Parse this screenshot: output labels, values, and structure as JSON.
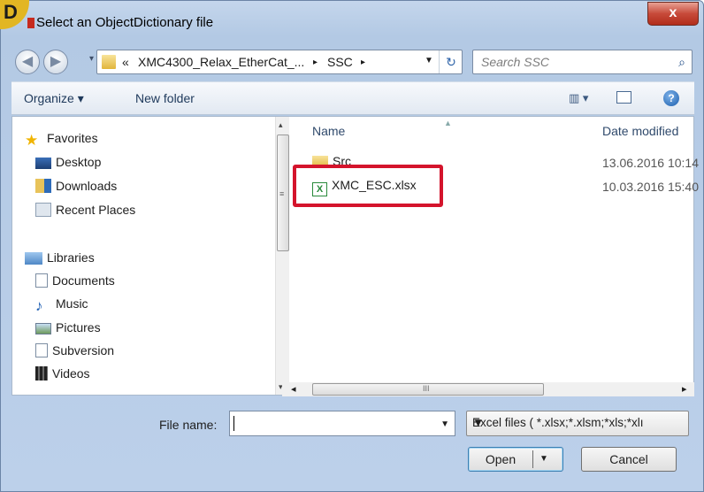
{
  "window": {
    "title": "Select an ObjectDictionary file",
    "close_label": "x",
    "badge_letter": "D"
  },
  "address": {
    "history": "«",
    "crumbs": [
      "XMC4300_Relax_EtherCat_...",
      "SSC"
    ],
    "sep": "▸",
    "refresh": "↻"
  },
  "search": {
    "placeholder": "Search SSC",
    "icon": "⌕"
  },
  "toolbar": {
    "organize": "Organize ▾",
    "new_folder": "New folder",
    "views": "▥ ▾",
    "help": "?"
  },
  "nav": {
    "favorites": {
      "label": "Favorites",
      "items": [
        "Desktop",
        "Downloads",
        "Recent Places"
      ]
    },
    "libraries": {
      "label": "Libraries",
      "items": [
        "Documents",
        "Music",
        "Pictures",
        "Subversion",
        "Videos"
      ]
    }
  },
  "files": {
    "columns": {
      "name": "Name",
      "date": "Date modified"
    },
    "rows": [
      {
        "name": "Src",
        "date": "13.06.2016 10:14",
        "icon": "folder-icon"
      },
      {
        "name": "XMC_ESC.xlsx",
        "date": "10.03.2016 15:40",
        "icon": "excel-file-icon"
      }
    ]
  },
  "scroll": {
    "left": "◂",
    "right": "▸",
    "up": "▴",
    "down": "▾",
    "grip": "≡",
    "hgrip": "III"
  },
  "bottom": {
    "filename_label": "File name:",
    "filename_value": "",
    "filetype": "Excel files  ( *.xlsx;*.xlsm;*xls;*xlı",
    "open": "Open",
    "cancel": "Cancel"
  },
  "colors": {
    "highlight": "#d4142c",
    "badge": "#e2b623"
  }
}
